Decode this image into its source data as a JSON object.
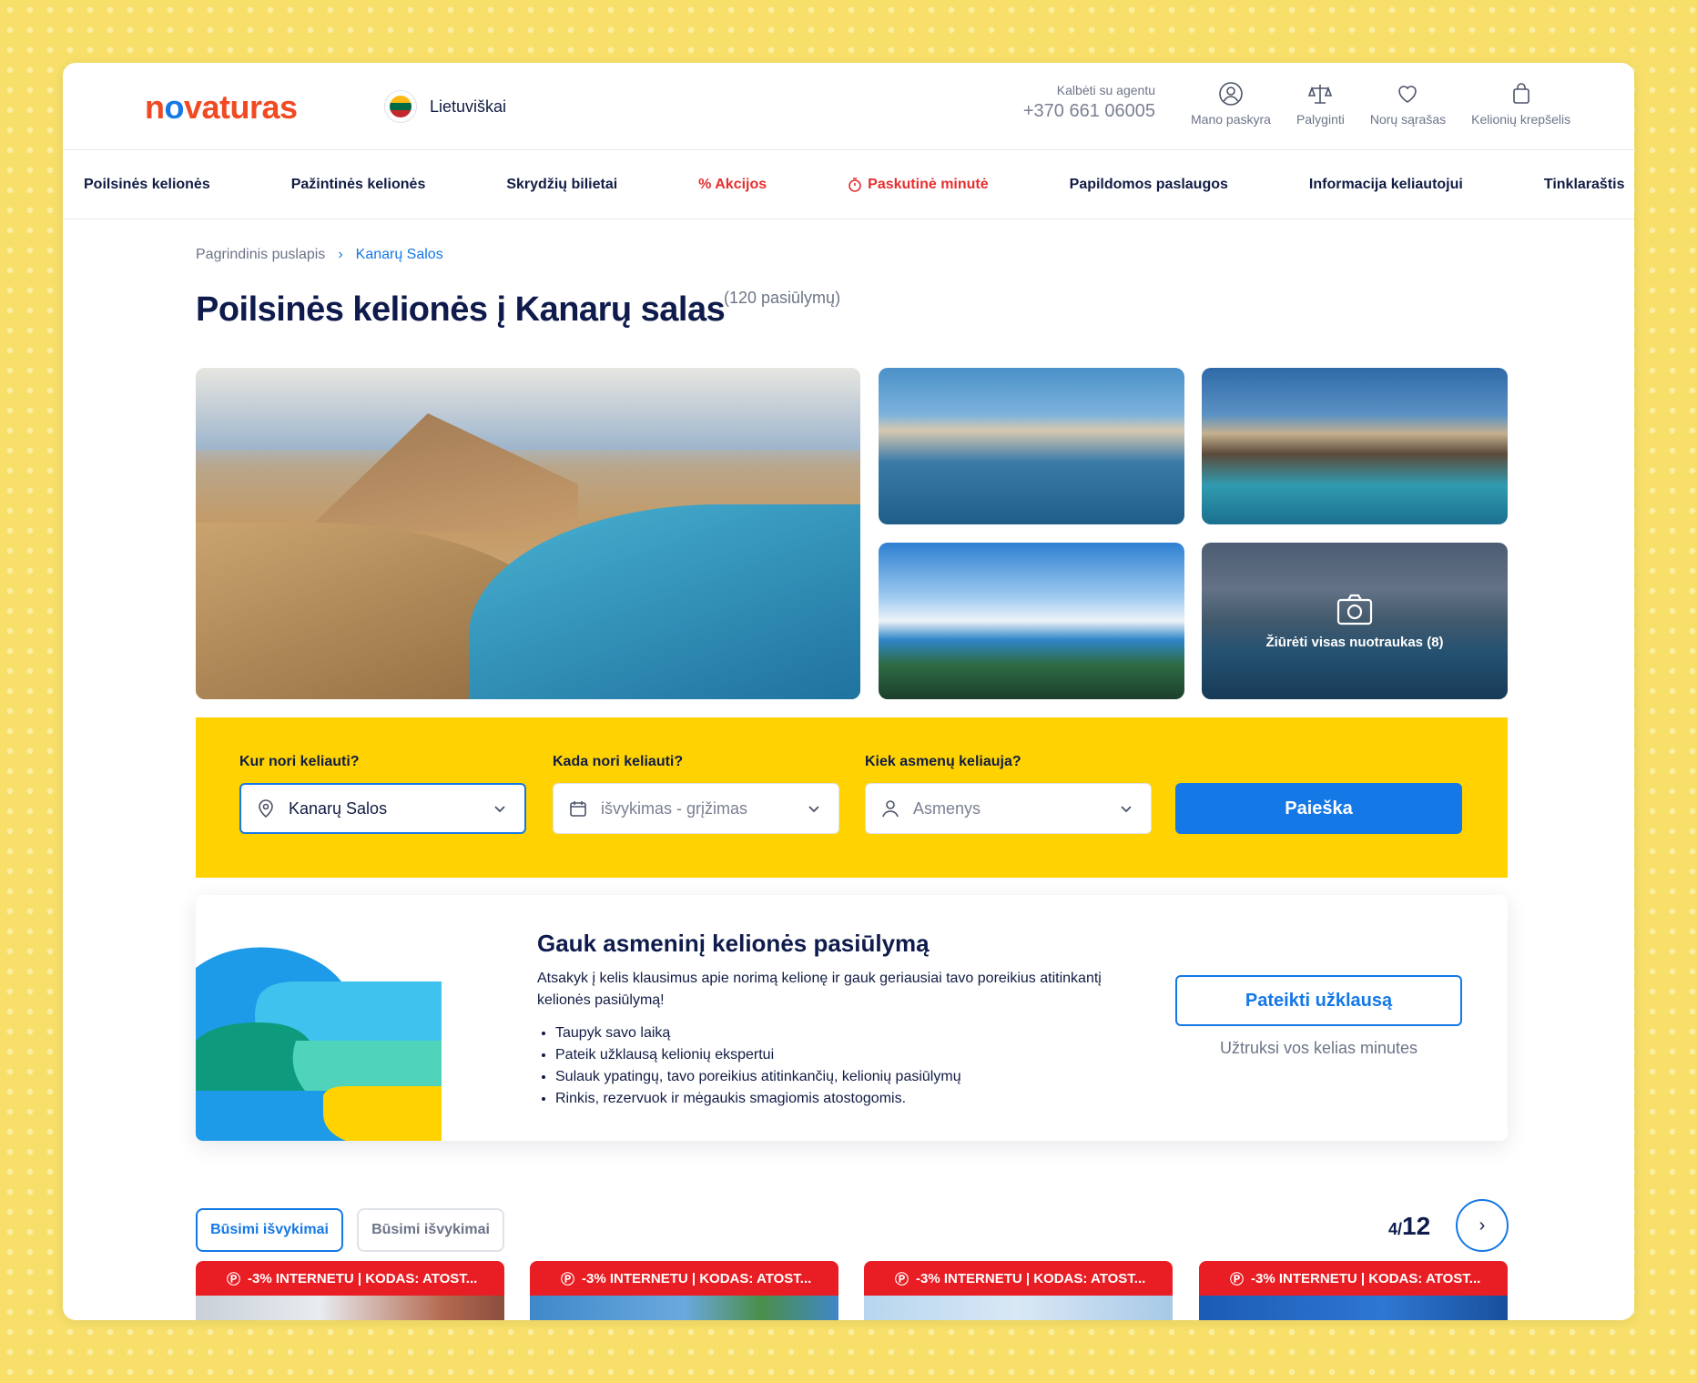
{
  "header": {
    "logo": "novaturas",
    "language": "Lietuviškai",
    "agent_label": "Kalbėti su agentu",
    "agent_phone": "+370 661 06005",
    "icons": [
      {
        "label": "Mano paskyra",
        "icon": "user-icon"
      },
      {
        "label": "Palyginti",
        "icon": "compare-scale-icon"
      },
      {
        "label": "Norų sąrašas",
        "icon": "heart-icon"
      },
      {
        "label": "Kelionių krepšelis",
        "icon": "cart-bag-icon"
      }
    ]
  },
  "nav": [
    {
      "label": "Poilsinės kelionės"
    },
    {
      "label": "Pažintinės kelionės"
    },
    {
      "label": "Skrydžių bilietai"
    },
    {
      "label": "% Akcijos"
    },
    {
      "label": "Paskutinė minutė"
    },
    {
      "label": "Papildomos paslaugos"
    },
    {
      "label": "Informacija keliautojui"
    },
    {
      "label": "Tinklaraštis"
    }
  ],
  "breadcrumb": {
    "home": "Pagrindinis puslapis",
    "current": "Kanarų Salos"
  },
  "page": {
    "title": "Poilsinės kelionės į Kanarų salas",
    "count": "(120 pasiūlymų)"
  },
  "gallery": {
    "view_all": "Žiūrėti visas nuotraukas (8)"
  },
  "search": {
    "where_label": "Kur nori keliauti?",
    "where_value": "Kanarų Salos",
    "when_label": "Kada nori keliauti?",
    "when_placeholder": "išvykimas - grįžimas",
    "who_label": "Kiek asmenų keliauja?",
    "who_placeholder": "Asmenys",
    "button": "Paieška"
  },
  "offer": {
    "heading": "Gauk asmeninį kelionės pasiūlymą",
    "text": "Atsakyk į kelis klausimus apie norimą kelionę ir gauk geriausiai tavo poreikius atitinkantį kelionės pasiūlymą!",
    "bullets": [
      "Taupyk savo laiką",
      "Pateik užklausą kelionių ekspertui",
      "Sulauk ypatingų, tavo poreikius atitinkančių, kelionių pasiūlymų",
      "Rinkis, rezervuok ir mėgaukis smagiomis atostogomis."
    ],
    "button": "Pateikti užklausą",
    "note": "Užtruksi vos kelias minutes"
  },
  "listing": {
    "tabs": [
      "Būsimi išvykimai",
      "Būsimi išvykimai"
    ],
    "pager_current": "4/",
    "pager_total": "12",
    "badges": [
      "-3% INTERNETU | KODAS: ATOST...",
      "-3% INTERNETU | KODAS: ATOST...",
      "-3% INTERNETU | KODAS: ATOST...",
      "-3% INTERNETU | KODAS: ATOST..."
    ]
  },
  "colors": {
    "accent": "#1478e6",
    "brand_orange": "#ef4a23",
    "search_yellow": "#ffd200",
    "sale_red": "#e81e24"
  }
}
